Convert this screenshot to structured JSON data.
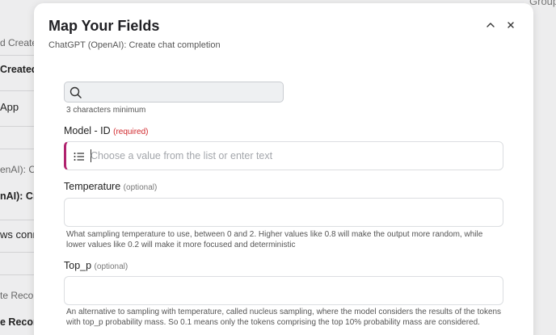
{
  "background": {
    "top_right": "Group",
    "rows": [
      {
        "text": "d Create",
        "style": "normal"
      },
      {
        "text": "Created",
        "style": "bold"
      },
      {
        "text": "App",
        "style": "big"
      },
      {
        "text": "enAI): C",
        "style": "normal"
      },
      {
        "text": "nAI): Cr",
        "style": "bold"
      },
      {
        "text": "ws conn",
        "style": "big"
      },
      {
        "text": "te Reco",
        "style": "normal"
      },
      {
        "text": "e Record",
        "style": "bold"
      }
    ]
  },
  "modal": {
    "title": "Map Your Fields",
    "subtitle": "ChatGPT (OpenAI): Create chat completion",
    "collapse_icon": "chevron-up-icon",
    "close_icon": "close-icon",
    "search": {
      "placeholder": "",
      "value": "",
      "hint": "3 characters minimum"
    },
    "fields": {
      "model": {
        "label": "Model - ID",
        "tag": "(required)",
        "placeholder": "Choose a value from the list or enter text",
        "accent_color": "#b0226e"
      },
      "temperature": {
        "label": "Temperature",
        "tag": "(optional)",
        "value": "",
        "description": "What sampling temperature to use, between 0 and 2. Higher values like 0.8 will make the output more random, while lower values like 0.2 will make it more focused and deterministic"
      },
      "top_p": {
        "label": "Top_p",
        "tag": "(optional)",
        "value": "",
        "description": "An alternative to sampling with temperature, called nucleus sampling, where the model considers the results of the tokens with top_p probability mass. So 0.1 means only the tokens comprising the top 10% probability mass are considered."
      }
    }
  }
}
